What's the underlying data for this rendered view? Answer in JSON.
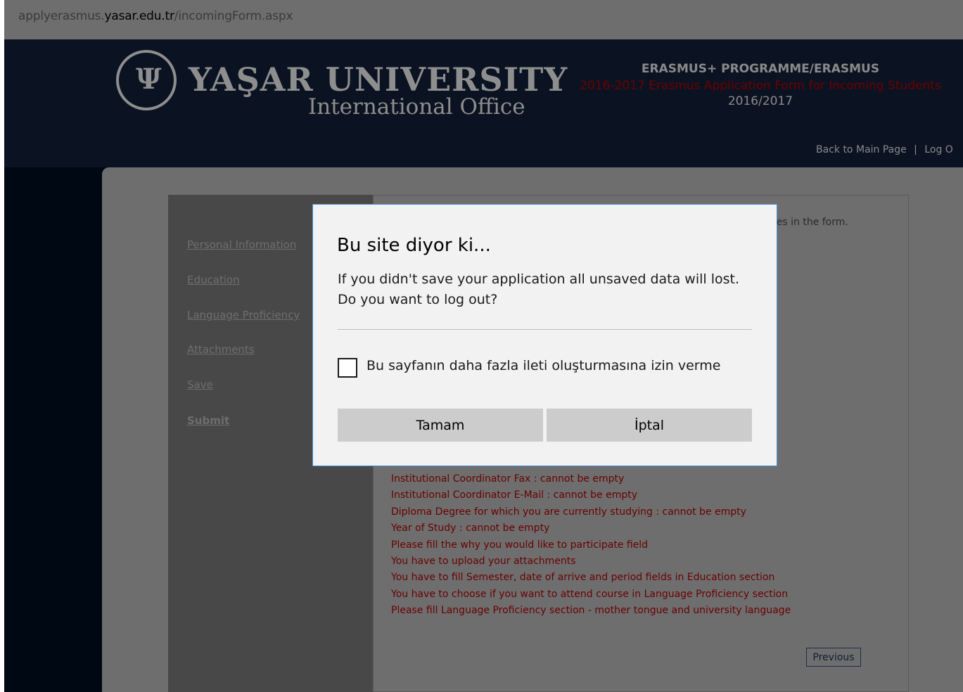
{
  "browser": {
    "url_prefix": "applyerasmus.",
    "url_host": "yasar.edu.tr",
    "url_path": "/incomingForm.aspx"
  },
  "header": {
    "university": "YAŞAR UNIVERSITY",
    "office": "International Office",
    "programme": "ERASMUS+ PROGRAMME/ERASMUS",
    "form_title": "2016-2017 Erasmus Application Form for Incoming Students",
    "year": "2016/2017",
    "back_link": "Back to Main Page",
    "separator": "|",
    "logout_link": "Log O"
  },
  "menu": {
    "items": [
      {
        "label": "Personal Information"
      },
      {
        "label": "Education"
      },
      {
        "label": "Language Proficiency"
      },
      {
        "label": "Attachments"
      },
      {
        "label": "Save"
      },
      {
        "label": "Submit"
      }
    ]
  },
  "content": {
    "note": "nges in the form.",
    "errors": [
      "Institutional Coordinator Fax : cannot be empty",
      "Institutional Coordinator E-Mail : cannot be empty",
      "Diploma Degree for which you are currently studying : cannot be empty",
      "Year of Study : cannot be empty",
      "Please fill the why you would like to participate field",
      "You have to upload your attachments",
      "You have to fill Semester, date of arrive and period fields in Education section",
      "You have to choose if you want to attend course in Language Proficiency section",
      "Please fill Language Proficiency section - mother tongue and university language"
    ],
    "previous_button": "Previous"
  },
  "dialog": {
    "title": "Bu site diyor ki...",
    "message_line1": "If you didn't save your application all unsaved data will lost.",
    "message_line2": "Do you want to log out?",
    "checkbox_label": "Bu sayfanın daha fazla ileti oluşturmasına izin verme",
    "ok_label": "Tamam",
    "cancel_label": "İptal"
  }
}
